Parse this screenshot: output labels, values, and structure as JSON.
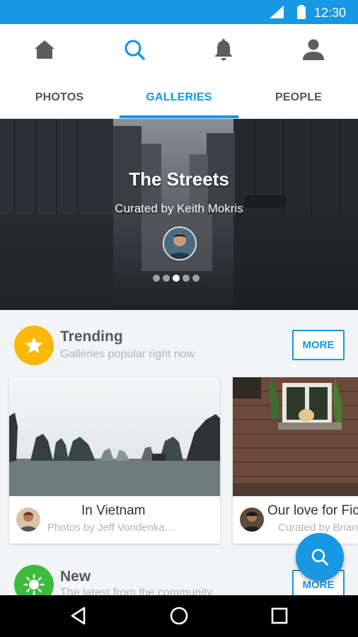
{
  "status_bar": {
    "time": "12:30",
    "background": "#1897e2"
  },
  "top_nav": {
    "icons": [
      "home-icon",
      "search-icon",
      "bell-icon",
      "person-icon"
    ],
    "active": "search-icon",
    "accent": "#1897e2"
  },
  "tabs": [
    {
      "label": "PHOTOS"
    },
    {
      "label": "GALLERIES"
    },
    {
      "label": "PEOPLE"
    }
  ],
  "hero": {
    "title": "The Streets",
    "subtitle": "Curated by Keith Mokris",
    "page_indicator": {
      "count": 5,
      "active_index": 2
    }
  },
  "trending": {
    "title": "Trending",
    "subtitle": "Galleries popular right now",
    "more_label": "MORE",
    "icon": "star-icon",
    "icon_color": "#fbb806",
    "cards": [
      {
        "title": "In Vietnam",
        "byline": "Photos by Jeff Vondenka…"
      },
      {
        "title": "Our love for Fic",
        "byline": "Curated by Brian"
      }
    ]
  },
  "new_section": {
    "title": "New",
    "subtitle": "The latest from the community",
    "more_label": "MORE",
    "icon": "sun-icon",
    "icon_color": "#3dbb3d"
  },
  "fab": {
    "icon": "search-icon"
  },
  "system_nav": {
    "icons": [
      "back-icon",
      "home-circle-icon",
      "recents-icon"
    ]
  }
}
